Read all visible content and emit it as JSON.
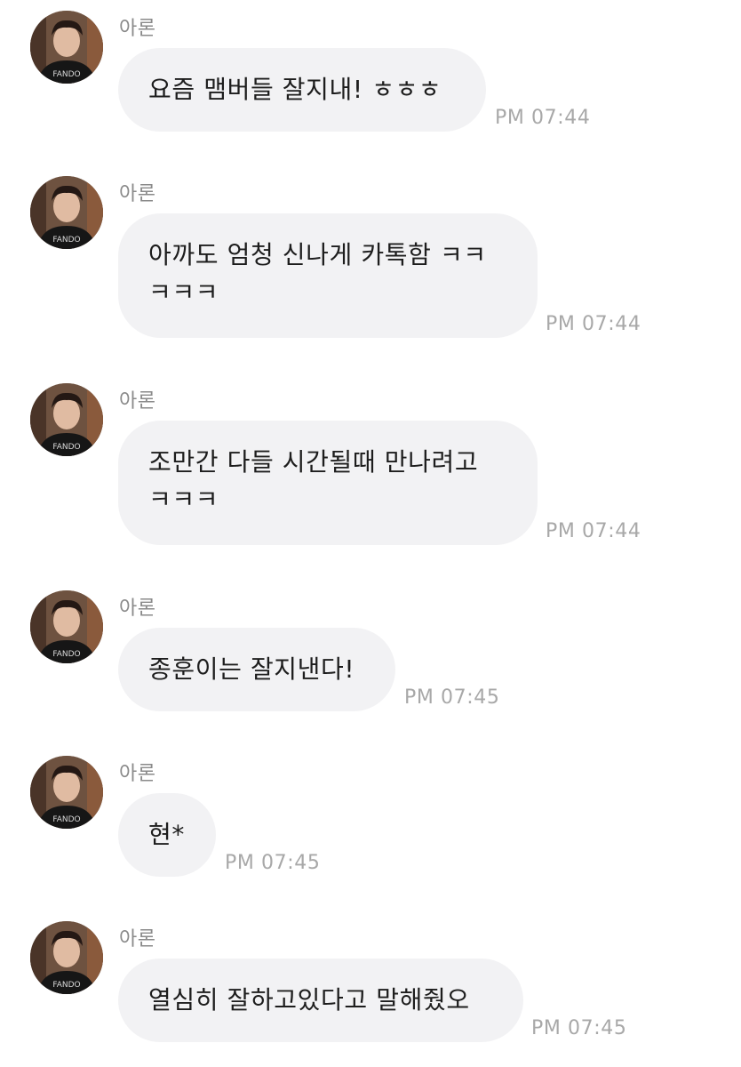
{
  "chat": {
    "messages": [
      {
        "sender": "아론",
        "text": "요즘 맴버들 잘지내! ㅎㅎㅎ",
        "time": "PM 07:44"
      },
      {
        "sender": "아론",
        "text": "아까도 엄청 신나게 카톡함 ㅋㅋ\nㅋㅋㅋ",
        "time": "PM 07:44"
      },
      {
        "sender": "아론",
        "text": "조만간 다들 시간될때 만나려고\nㅋㅋㅋ",
        "time": "PM 07:44"
      },
      {
        "sender": "아론",
        "text": "종훈이는 잘지낸다!",
        "time": "PM 07:45"
      },
      {
        "sender": "아론",
        "text": "현*",
        "time": "PM 07:45"
      },
      {
        "sender": "아론",
        "text": "열심히 잘하고있다고 말해줬오",
        "time": "PM 07:45"
      }
    ],
    "avatar_icon": "profile-photo",
    "colors": {
      "bubble": "#f2f2f4",
      "sender": "#8a8a8a",
      "time": "#a8a8a8",
      "text": "#1d1d1d",
      "background": "#ffffff"
    }
  }
}
